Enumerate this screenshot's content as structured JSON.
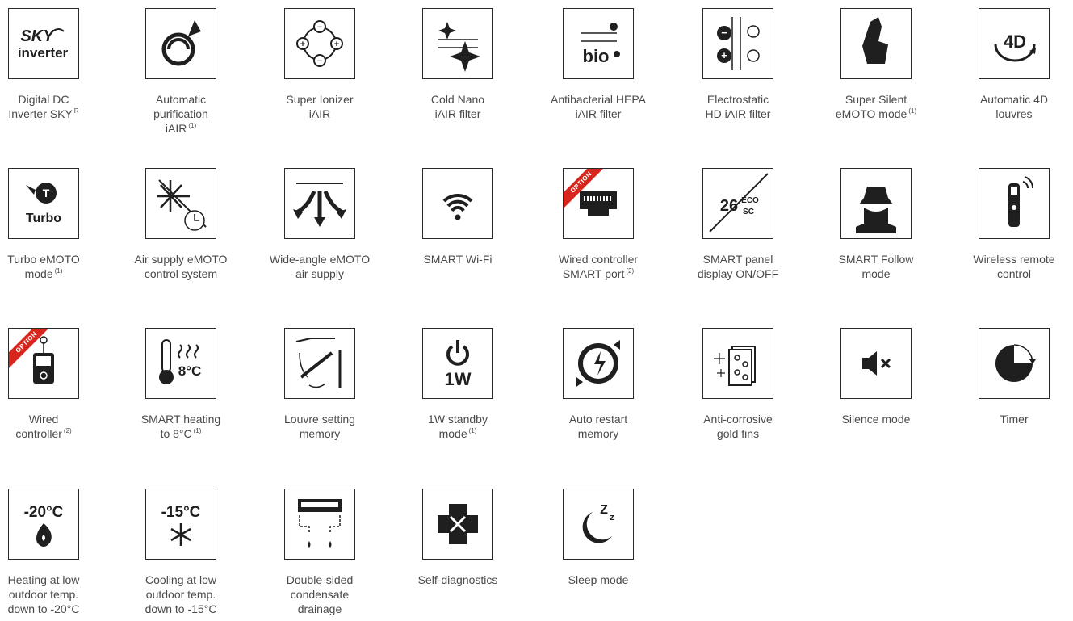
{
  "colors": {
    "icon": "#1f1f1f",
    "border": "#2a2a2a",
    "text": "#4a4a4a",
    "badge": "#d7261e"
  },
  "features": [
    {
      "icon": "sky-inverter-icon",
      "label": "Digital DC\nInverter SKY",
      "sup": "R",
      "glyph": "SKY\ninverter"
    },
    {
      "icon": "purification-icon",
      "label": "Automatic\npurification\niAIR",
      "sup": "(1)"
    },
    {
      "icon": "ionizer-icon",
      "label": "Super Ionizer\niAIR"
    },
    {
      "icon": "cold-nano-icon",
      "label": "Cold Nano\niAIR filter"
    },
    {
      "icon": "hepa-icon",
      "label": "Antibacterial HEPA\niAIR filter",
      "glyph": "bio"
    },
    {
      "icon": "electrostatic-icon",
      "label": "Electrostatic\nHD iAIR filter"
    },
    {
      "icon": "silent-icon",
      "label": "Super Silent\neMOTO mode",
      "sup": "(1)"
    },
    {
      "icon": "louvres-4d-icon",
      "label": "Automatic 4D\nlouvres",
      "glyph": "4D"
    },
    {
      "icon": "turbo-icon",
      "label": "Turbo eMOTO\nmode",
      "sup": "(1)",
      "glyph": "Turbo"
    },
    {
      "icon": "air-supply-icon",
      "label": "Air supply eMOTO\ncontrol system"
    },
    {
      "icon": "wide-angle-icon",
      "label": "Wide-angle eMOTO\nair supply"
    },
    {
      "icon": "wifi-icon",
      "label": "SMART Wi-Fi"
    },
    {
      "icon": "wired-port-icon",
      "label": "Wired controller\nSMART port",
      "sup": "(2)",
      "badge": "OPTION"
    },
    {
      "icon": "panel-display-icon",
      "label": "SMART panel\ndisplay ON/OFF",
      "glyph": "26"
    },
    {
      "icon": "follow-icon",
      "label": "SMART Follow\nmode"
    },
    {
      "icon": "remote-icon",
      "label": "Wireless remote\ncontrol"
    },
    {
      "icon": "wired-controller-icon",
      "label": "Wired\ncontroller",
      "sup": "(2)",
      "badge": "OPTION"
    },
    {
      "icon": "heating-8c-icon",
      "label": "SMART heating\nto 8°C",
      "sup": "(1)",
      "glyph": "8°C"
    },
    {
      "icon": "louvre-memory-icon",
      "label": "Louvre setting\nmemory"
    },
    {
      "icon": "standby-icon",
      "label": "1W standby\nmode",
      "sup": "(1)",
      "glyph": "1W"
    },
    {
      "icon": "auto-restart-icon",
      "label": "Auto restart\nmemory"
    },
    {
      "icon": "gold-fins-icon",
      "label": "Anti-corrosive\ngold fins"
    },
    {
      "icon": "silence-icon",
      "label": "Silence mode"
    },
    {
      "icon": "timer-icon",
      "label": "Timer"
    },
    {
      "icon": "heating-low-icon",
      "label": "Heating at low\noutdoor temp.\ndown to -20°C",
      "glyph": "-20°C"
    },
    {
      "icon": "cooling-low-icon",
      "label": "Cooling at low\noutdoor temp.\ndown to -15°C",
      "glyph": "-15°C"
    },
    {
      "icon": "drainage-icon",
      "label": "Double-sided\ncondensate\ndrainage"
    },
    {
      "icon": "self-diagnostics-icon",
      "label": "Self-diagnostics"
    },
    {
      "icon": "sleep-icon",
      "label": "Sleep mode",
      "glyph": "Z"
    }
  ]
}
